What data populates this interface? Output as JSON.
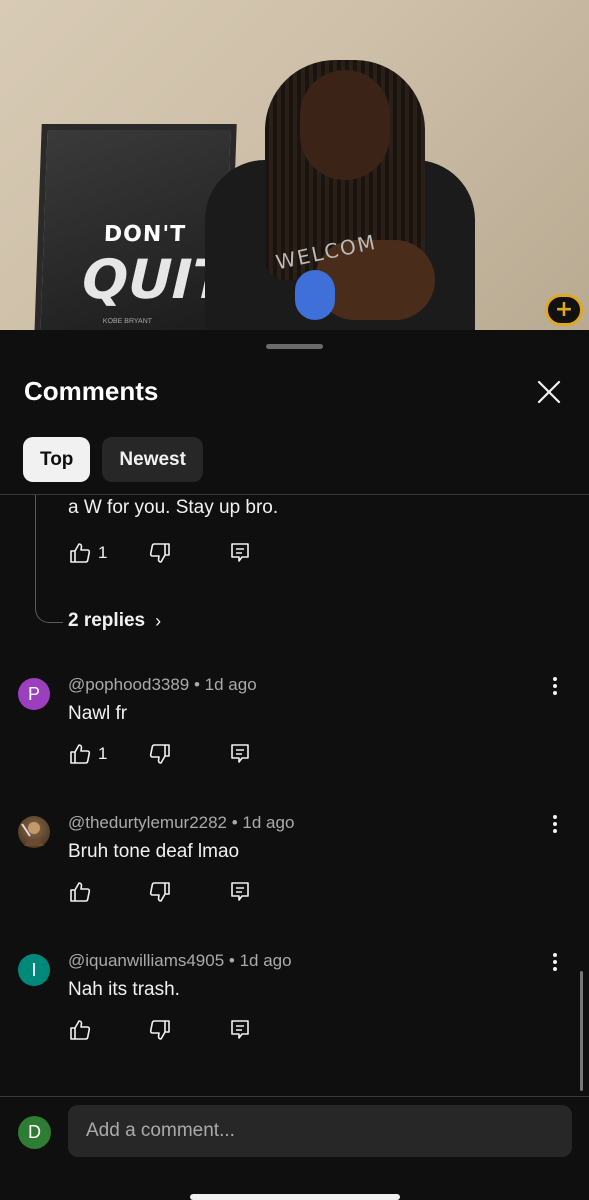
{
  "video": {
    "poster_line1": "DON'T",
    "poster_line2": "QUIT",
    "poster_credit": "KOBE BRYANT",
    "shirt_text": "WELCOM"
  },
  "sheet": {
    "title": "Comments",
    "close_icon": "close-icon",
    "tabs": [
      {
        "label": "Top",
        "active": true
      },
      {
        "label": "Newest",
        "active": false
      }
    ]
  },
  "continued_comment": {
    "text": "a W for you. Stay up bro.",
    "likes": "1",
    "replies_label": "2 replies"
  },
  "comments": [
    {
      "author": "@pophood3389",
      "age": "1d ago",
      "text": "Nawl fr",
      "likes": "1",
      "avatar_letter": "P",
      "avatar_color": "#9c3fbf"
    },
    {
      "author": "@thedurtylemur2282",
      "age": "1d ago",
      "text": "Bruh tone deaf lmao",
      "likes": "",
      "avatar_letter": "",
      "avatar_color": "#5a4a3a"
    },
    {
      "author": "@iquanwilliams4905",
      "age": "1d ago",
      "text": "Nah its trash.",
      "likes": "",
      "avatar_letter": "I",
      "avatar_color": "#00897b"
    }
  ],
  "composer": {
    "avatar_letter": "D",
    "avatar_color": "#2e7d32",
    "placeholder": "Add a comment..."
  },
  "colors": {
    "background": "#0f0f0f",
    "text": "#f1f1f1",
    "secondary_text": "#aaaaaa",
    "chip_inactive": "#272727"
  }
}
